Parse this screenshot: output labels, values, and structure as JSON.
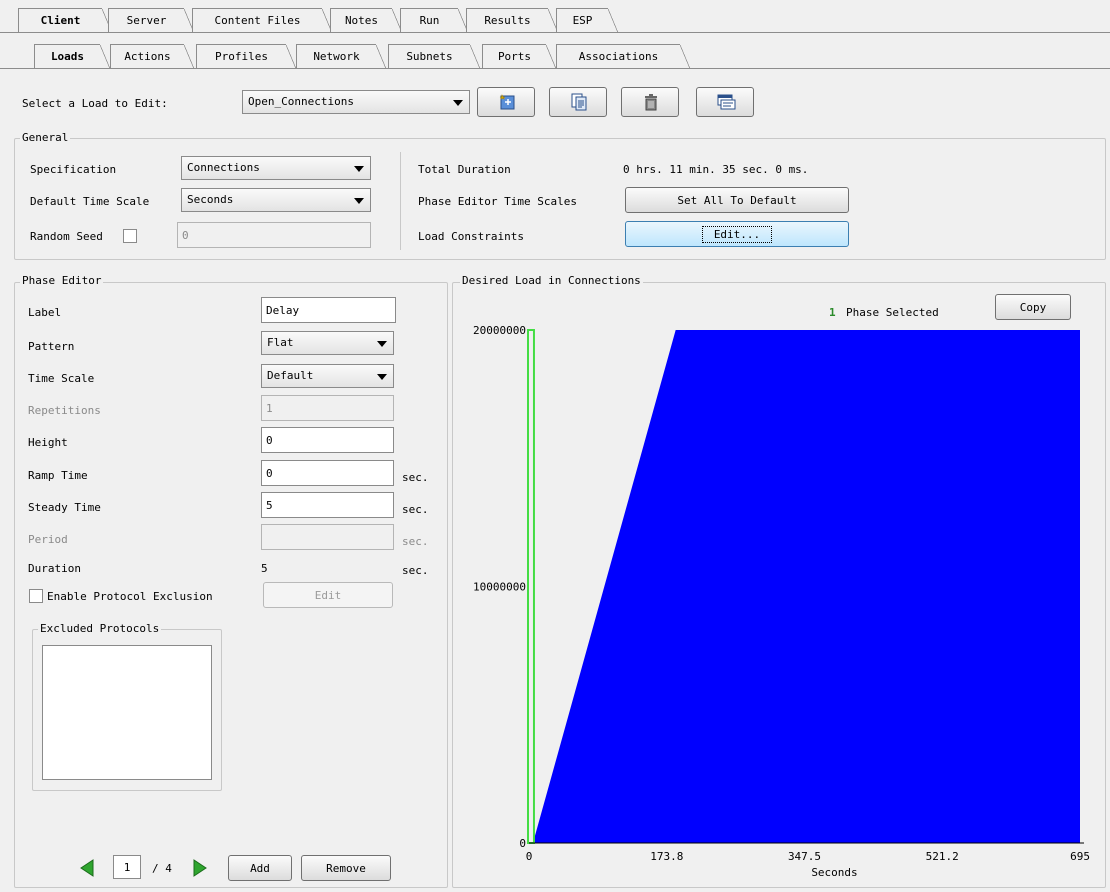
{
  "tabs_main": [
    {
      "label": "Client",
      "active": true
    },
    {
      "label": "Server",
      "active": false
    },
    {
      "label": "Content Files",
      "active": false
    },
    {
      "label": "Notes",
      "active": false
    },
    {
      "label": "Run",
      "active": false
    },
    {
      "label": "Results",
      "active": false
    },
    {
      "label": "ESP",
      "active": false
    }
  ],
  "tabs_sub": [
    {
      "label": "Loads",
      "active": true
    },
    {
      "label": "Actions",
      "active": false
    },
    {
      "label": "Profiles",
      "active": false
    },
    {
      "label": "Network",
      "active": false
    },
    {
      "label": "Subnets",
      "active": false
    },
    {
      "label": "Ports",
      "active": false
    },
    {
      "label": "Associations",
      "active": false
    }
  ],
  "load_select": {
    "label": "Select a Load to Edit:",
    "value": "Open_Connections"
  },
  "toolbar_icons": [
    "new-load-icon",
    "copy-load-icon",
    "delete-load-icon",
    "rename-load-icon"
  ],
  "general": {
    "title": "General",
    "specification_label": "Specification",
    "specification_value": "Connections",
    "time_scale_label": "Default Time Scale",
    "time_scale_value": "Seconds",
    "random_seed_label": "Random Seed",
    "random_seed_value": "0",
    "total_duration_label": "Total Duration",
    "total_duration_value": "0 hrs. 11 min. 35 sec. 0 ms.",
    "phase_scales_label": "Phase Editor Time Scales",
    "phase_scales_button": "Set All To Default",
    "constraints_label": "Load Constraints",
    "constraints_button": "Edit..."
  },
  "phase_editor": {
    "title": "Phase Editor",
    "label_label": "Label",
    "label_value": "Delay",
    "pattern_label": "Pattern",
    "pattern_value": "Flat",
    "time_scale_label": "Time Scale",
    "time_scale_value": "Default",
    "repetitions_label": "Repetitions",
    "repetitions_value": "1",
    "height_label": "Height",
    "height_value": "0",
    "ramp_label": "Ramp Time",
    "ramp_value": "0",
    "steady_label": "Steady Time",
    "steady_value": "5",
    "period_label": "Period",
    "period_value": "",
    "duration_label": "Duration",
    "duration_value": "5",
    "unit": "sec.",
    "exclusion_label": "Enable Protocol Exclusion",
    "exclusion_button": "Edit",
    "excluded_title": "Excluded Protocols",
    "page_current": "1",
    "page_total": "/ 4",
    "add_button": "Add",
    "remove_button": "Remove"
  },
  "chart_panel": {
    "title": "Desired Load in Connections",
    "selected_count": "1",
    "selected_text": "Phase Selected",
    "copy_button": "Copy"
  },
  "chart_data": {
    "type": "area",
    "xlabel": "Seconds",
    "ylabel": "",
    "xlim": [
      0,
      695
    ],
    "ylim": [
      0,
      20000000
    ],
    "x_ticks": [
      "0",
      "173.8",
      "347.5",
      "521.2",
      "695"
    ],
    "y_ticks": [
      "0",
      "10000000",
      "20000000"
    ],
    "x": [
      0,
      5,
      185,
      695
    ],
    "y": [
      0,
      0,
      20000000,
      20000000
    ],
    "fill_color": "#0000ff",
    "selected_phase_color": "#44dd44",
    "selected_phase_x": [
      0,
      5
    ]
  }
}
